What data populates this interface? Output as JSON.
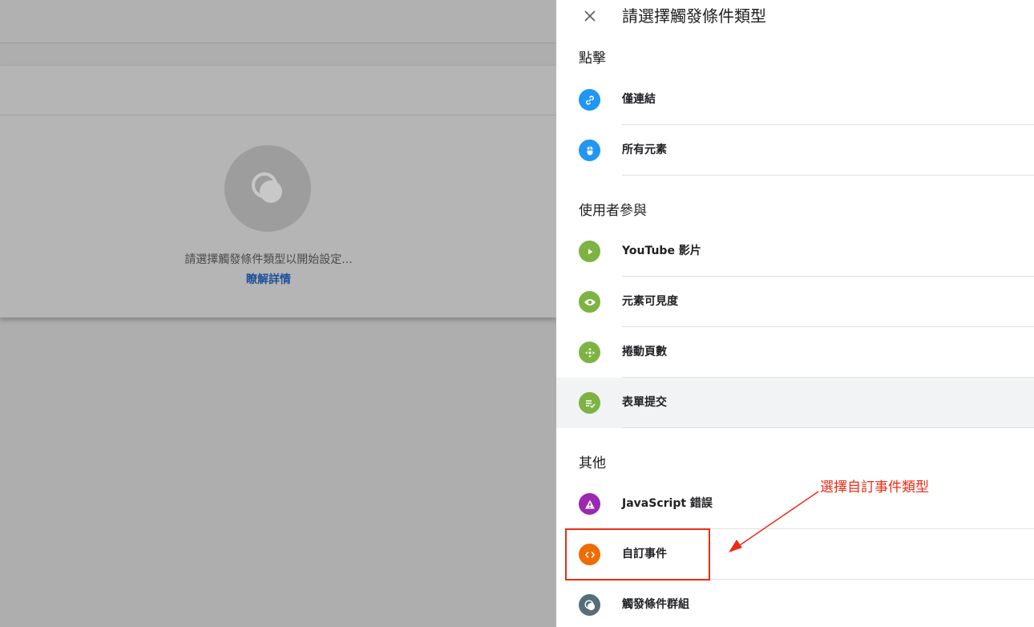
{
  "background": {
    "hint_text": "請選擇觸發條件類型以開始設定...",
    "learn_more_link": "瞭解詳情"
  },
  "sheet": {
    "title": "請選擇觸發條件類型",
    "sections": [
      {
        "title": "點擊",
        "items": [
          {
            "label": "僅連結",
            "icon": "link-icon",
            "color": "#2196f3"
          },
          {
            "label": "所有元素",
            "icon": "mouse-icon",
            "color": "#2196f3"
          }
        ]
      },
      {
        "title": "使用者參與",
        "items": [
          {
            "label": "YouTube 影片",
            "icon": "play-icon",
            "color": "#7cb342"
          },
          {
            "label": "元素可見度",
            "icon": "eye-icon",
            "color": "#7cb342"
          },
          {
            "label": "捲動頁數",
            "icon": "scroll-icon",
            "color": "#7cb342"
          },
          {
            "label": "表單提交",
            "icon": "form-submit-icon",
            "color": "#7cb342"
          }
        ]
      },
      {
        "title": "其他",
        "items": [
          {
            "label": "JavaScript 錯誤",
            "icon": "warning-icon",
            "color": "#9c27b0"
          },
          {
            "label": "自訂事件",
            "icon": "code-icon",
            "color": "#ef6c00"
          },
          {
            "label": "觸發條件群組",
            "icon": "trigger-group-icon",
            "color": "#546e7a"
          }
        ]
      }
    ]
  },
  "annotation": {
    "text": "選擇自訂事件類型",
    "color": "#ee2b14"
  }
}
